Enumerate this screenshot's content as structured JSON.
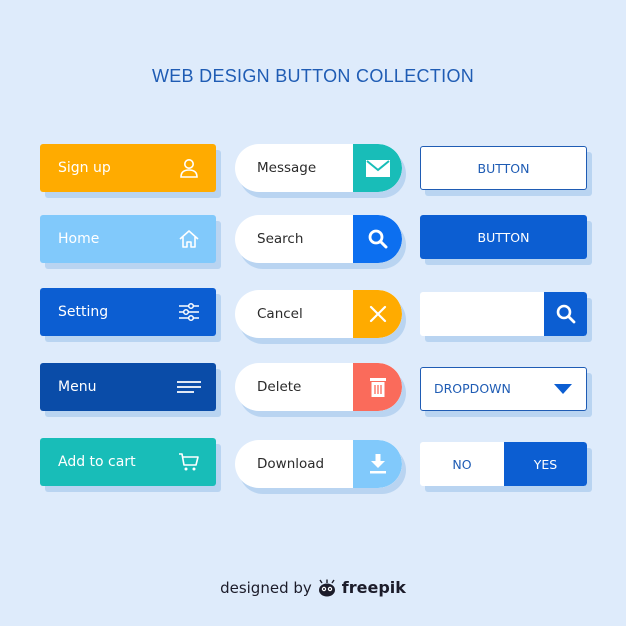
{
  "title": "WEB DESIGN BUTTON COLLECTION",
  "colors": {
    "background": "#deebfb",
    "title": "#1f5cb4",
    "orange": "#ffab00",
    "light_blue": "#81c9fb",
    "blue": "#0c5ed2",
    "dark_blue": "#0a4ca8",
    "teal": "#18bdb8",
    "red": "#fa6b5b",
    "shadow": "#b9d4f1"
  },
  "column1": [
    {
      "label": "Sign up",
      "icon": "user-icon",
      "color": "#ffab00"
    },
    {
      "label": "Home",
      "icon": "home-icon",
      "color": "#81c9fb"
    },
    {
      "label": "Setting",
      "icon": "sliders-icon",
      "color": "#0c5ed2"
    },
    {
      "label": "Menu",
      "icon": "menu-icon",
      "color": "#0a4ca8"
    },
    {
      "label": "Add to cart",
      "icon": "cart-icon",
      "color": "#18bdb8"
    }
  ],
  "column2": [
    {
      "label": "Message",
      "icon": "envelope-icon",
      "color": "#18bdb8"
    },
    {
      "label": "Search",
      "icon": "search-icon",
      "color": "#0c6ff0"
    },
    {
      "label": "Cancel",
      "icon": "close-icon",
      "color": "#ffab00"
    },
    {
      "label": "Delete",
      "icon": "trash-icon",
      "color": "#fa6b5b"
    },
    {
      "label": "Download",
      "icon": "download-icon",
      "color": "#81c9fb"
    }
  ],
  "column3": {
    "outline_button": "BUTTON",
    "solid_button": "BUTTON",
    "search_input": {
      "value": "",
      "placeholder": ""
    },
    "dropdown": {
      "selected": "DROPDOWN"
    },
    "toggle": {
      "no": "NO",
      "yes": "YES",
      "active": "YES"
    }
  },
  "footer": {
    "prefix": "designed by",
    "brand": "freepik"
  }
}
